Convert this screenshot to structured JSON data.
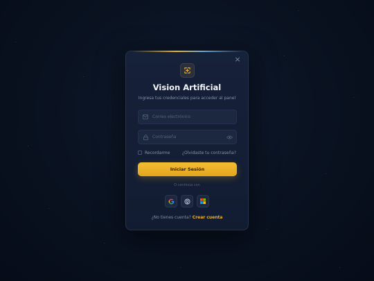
{
  "modal": {
    "close_glyph": "×",
    "title": "Vision Artificial",
    "subtitle": "Ingresa tus credenciales para acceder al panel",
    "email_placeholder": "Correo electrónico",
    "password_placeholder": "Contraseña",
    "remember_label": "Recordarme",
    "forgot_label": "¿Olvidaste tu contraseña?",
    "login_label": "Iniciar Sesión",
    "divider_label": "O continúa con",
    "signup_question": "¿No tienes cuenta?",
    "signup_link": "Crear cuenta"
  },
  "icons": {
    "logo": "logo-icon",
    "email": "mail-icon",
    "password": "lock-icon",
    "toggle": "eye-icon",
    "close": "close-icon",
    "social": [
      "google-icon",
      "github-icon",
      "microsoft-icon"
    ]
  },
  "colors": {
    "accent": "#f0b428",
    "background": "#0a1322",
    "modal": "#16213a",
    "input": "#1c2740"
  }
}
